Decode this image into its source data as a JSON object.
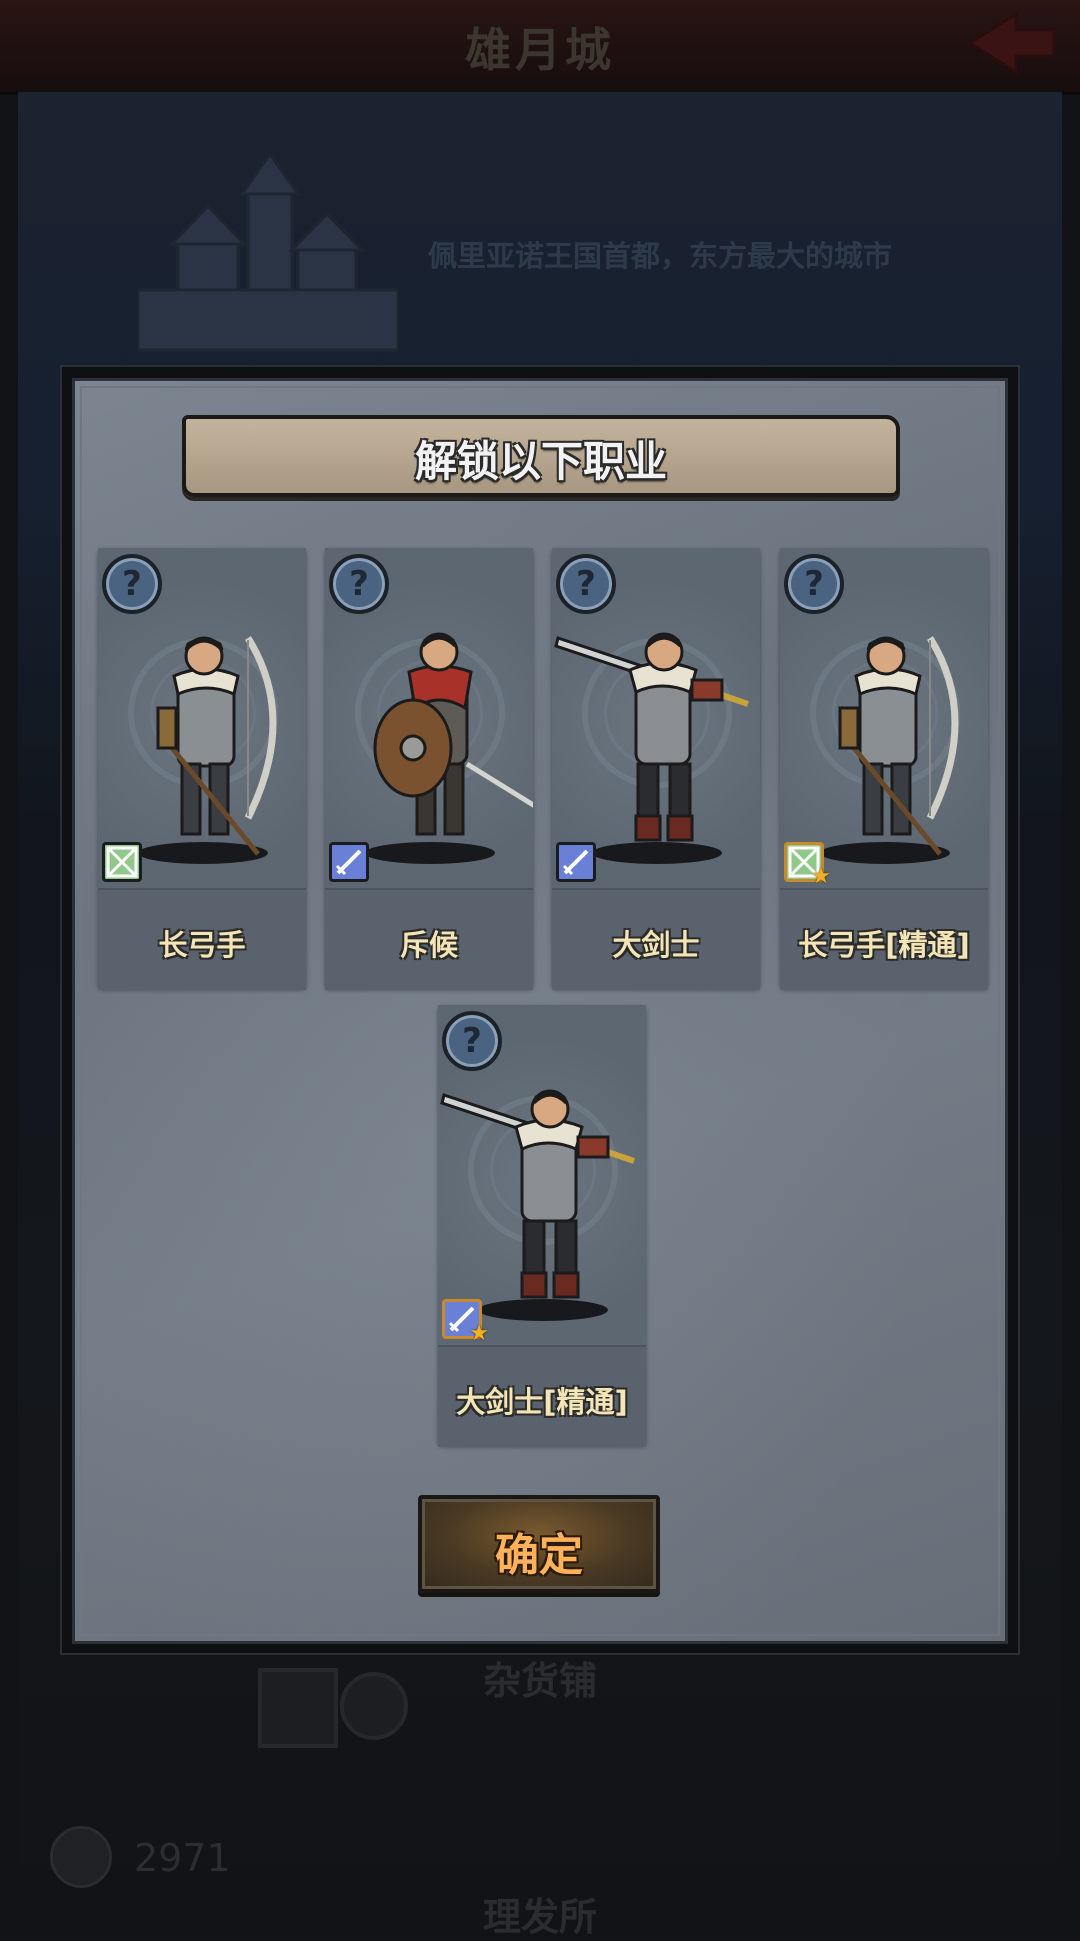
{
  "background": {
    "title": "雄月城",
    "description": "佩里亚诺王国首都，东方最大的城市",
    "shop_label": "杂货铺",
    "money": "2971",
    "barber_label": "理发所"
  },
  "modal": {
    "title": "解锁以下职业",
    "confirm_label": "确定",
    "help_glyph": "?",
    "star_glyph": "★",
    "classes": [
      {
        "name": "长弓手",
        "type_icon": "bow-icon",
        "elite": false,
        "figure": "archer"
      },
      {
        "name": "斥候",
        "type_icon": "sword-icon",
        "elite": false,
        "figure": "scout"
      },
      {
        "name": "大剑士",
        "type_icon": "sword-icon",
        "elite": false,
        "figure": "greatsword"
      },
      {
        "name": "长弓手[精通]",
        "type_icon": "bow-icon",
        "elite": true,
        "figure": "archer"
      },
      {
        "name": "大剑士[精通]",
        "type_icon": "sword-icon",
        "elite": true,
        "figure": "greatsword"
      }
    ]
  },
  "colors": {
    "bow_type": "#8fc98a",
    "sword_type": "#6a7fd6",
    "elite_border": "#c88a2a",
    "name_text": "#f4e5b6",
    "confirm_text": "#ffb25a"
  }
}
